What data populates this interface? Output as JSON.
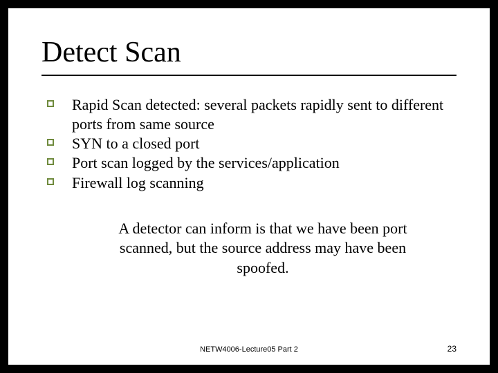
{
  "title": "Detect Scan",
  "bullets": [
    "Rapid Scan detected: several packets rapidly sent to different ports from same source",
    "SYN to a closed port",
    "Port scan logged by the services/application",
    "Firewall log scanning"
  ],
  "paragraph": "A detector can inform is that we have been port scanned, but the source address may have been spoofed.",
  "footer": {
    "center": "NETW4006-Lecture05 Part 2",
    "page": "23"
  }
}
